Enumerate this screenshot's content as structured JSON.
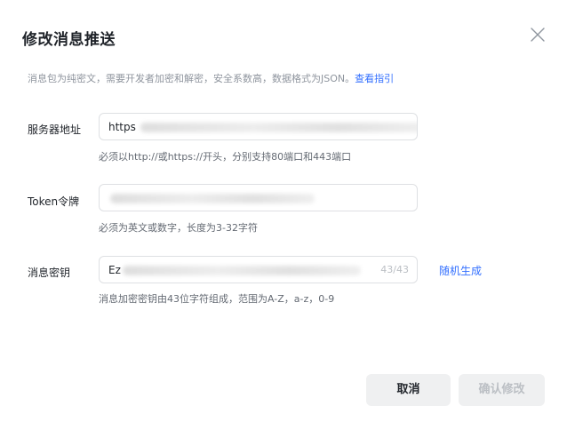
{
  "dialog": {
    "title": "修改消息推送",
    "description": "消息包为纯密文，需要开发者加密和解密，安全系数高，数据格式为JSON。",
    "guide_link": "查看指引"
  },
  "fields": {
    "server": {
      "label": "服务器地址",
      "value": "https",
      "hint": "必须以http://或https://开头，分别支持80端口和443端口"
    },
    "token": {
      "label": "Token令牌",
      "value": "",
      "hint": "必须为英文或数字，长度为3-32字符"
    },
    "key": {
      "label": "消息密钥",
      "value": "Ez",
      "counter": "43/43",
      "random_label": "随机生成",
      "hint": "消息加密密钥由43位字符组成，范围为A-Z，a-z，0-9"
    }
  },
  "footer": {
    "cancel_label": "取消",
    "confirm_label": "确认修改"
  },
  "icons": {
    "close": "close-icon"
  },
  "colors": {
    "link": "#3370ff",
    "disabled_text": "#bbbfc4",
    "button_bg": "#eff0f1"
  }
}
